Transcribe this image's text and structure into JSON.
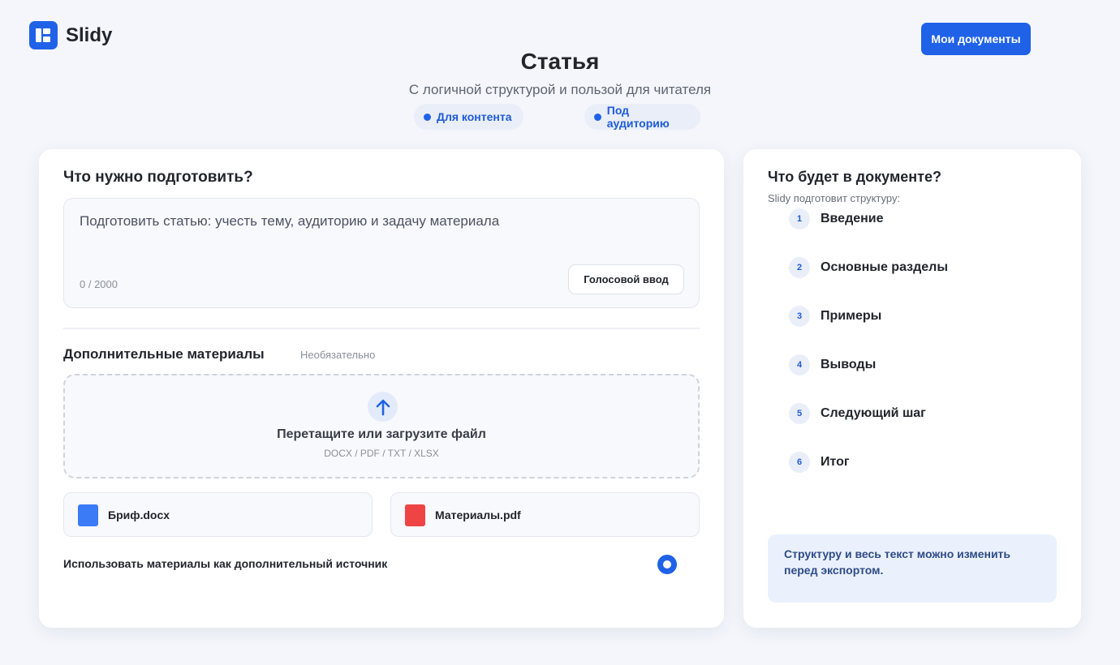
{
  "app": {
    "name": "Slidy"
  },
  "header": {
    "my_docs_label": "Мои документы"
  },
  "hero": {
    "title": "Статья",
    "subtitle": "С логичной структурой и пользой для читателя",
    "tags": [
      "Для контента",
      "Под аудиторию"
    ]
  },
  "prompt_section": {
    "title": "Что нужно подготовить?",
    "placeholder": "Подготовить статью: учесть тему, аудиторию и задачу материала",
    "counter": "0 / 2000",
    "voice_label": "Голосовой ввод"
  },
  "materials": {
    "title": "Дополнительные материалы",
    "optional_label": "Необязательно",
    "dropzone": {
      "icon": "upload-arrow-icon",
      "title": "Перетащите или загрузите файл",
      "formats": "DOCX / PDF / TXT / XLSX"
    },
    "files": [
      {
        "name": "Бриф.docx",
        "color": "#3b7bf5"
      },
      {
        "name": "Материалы.pdf",
        "color": "#ee4444"
      }
    ],
    "use_as_source_label": "Использовать материалы как дополнительный источник",
    "use_as_source_selected": true
  },
  "document_preview": {
    "title": "Что будет в документе?",
    "subtitle": "Slidy подготовит структуру:",
    "steps": [
      {
        "num": "1",
        "label": "Введение"
      },
      {
        "num": "2",
        "label": "Основные разделы"
      },
      {
        "num": "3",
        "label": "Примеры"
      },
      {
        "num": "4",
        "label": "Выводы"
      },
      {
        "num": "5",
        "label": "Следующий шаг"
      },
      {
        "num": "6",
        "label": "Итог"
      }
    ],
    "note": "Структуру и весь текст можно изменить перед экспортом."
  },
  "colors": {
    "accent": "#1f62e8",
    "background": "#f4f6fb",
    "note_bg": "#eaf1fd"
  }
}
